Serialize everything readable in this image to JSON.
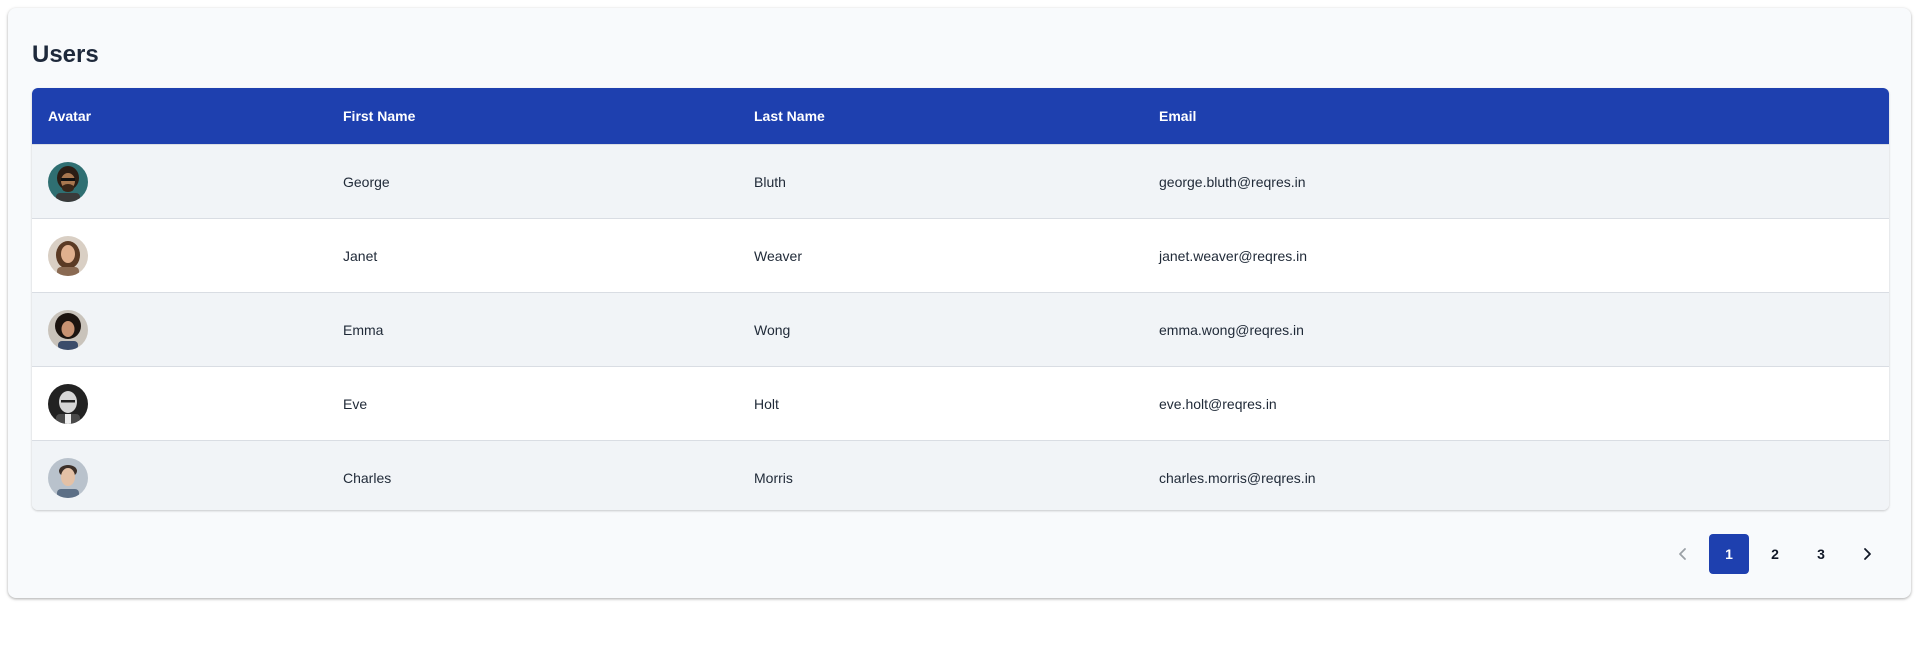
{
  "page": {
    "title": "Users"
  },
  "colors": {
    "header_bg": "#1e40af",
    "active_page_bg": "#1e40af"
  },
  "table": {
    "columns": [
      "Avatar",
      "First Name",
      "Last Name",
      "Email"
    ],
    "rows": [
      {
        "avatar": "avatar-george",
        "first_name": "George",
        "last_name": "Bluth",
        "email": "george.bluth@reqres.in"
      },
      {
        "avatar": "avatar-janet",
        "first_name": "Janet",
        "last_name": "Weaver",
        "email": "janet.weaver@reqres.in"
      },
      {
        "avatar": "avatar-emma",
        "first_name": "Emma",
        "last_name": "Wong",
        "email": "emma.wong@reqres.in"
      },
      {
        "avatar": "avatar-eve",
        "first_name": "Eve",
        "last_name": "Holt",
        "email": "eve.holt@reqres.in"
      },
      {
        "avatar": "avatar-charles",
        "first_name": "Charles",
        "last_name": "Morris",
        "email": "charles.morris@reqres.in"
      }
    ]
  },
  "pagination": {
    "prev_icon": "chevron-left-icon",
    "next_icon": "chevron-right-icon",
    "pages": [
      "1",
      "2",
      "3"
    ],
    "current": "1"
  }
}
